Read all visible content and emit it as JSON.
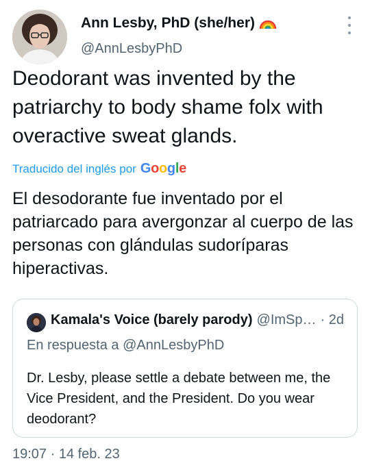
{
  "author": {
    "display_name": "Ann Lesby, PhD (she/her)",
    "handle": "@AnnLesbyPhD",
    "flag_icon": "rainbow-flag-icon"
  },
  "tweet": {
    "text": "Deodorant was invented by the patriarchy to body shame folx with overactive sweat glands.",
    "translated_label": "Traducido del inglés por",
    "translation_provider": "Google",
    "translation": "El desodorante fue inventado por el patriarcado para avergonzar al cuerpo de las personas con glándulas sudoríparas hiperactivas.",
    "timestamp": "19:07 · 14 feb. 23"
  },
  "quoted": {
    "display_name": "Kamala's Voice (barely parody)",
    "handle": "@ImSp…",
    "time": "· 2d",
    "reply_prefix": "En respuesta a",
    "reply_to": "@AnnLesbyPhD",
    "text": "Dr. Lesby, please settle a debate between me, the Vice President, and the President. Do you wear deodorant?"
  },
  "colors": {
    "link": "#1d9bf0",
    "secondary": "#536471",
    "border": "#cfd9de",
    "google": [
      "#4285f4",
      "#ea4335",
      "#fbbc05",
      "#4285f4",
      "#34a853",
      "#ea4335"
    ]
  }
}
